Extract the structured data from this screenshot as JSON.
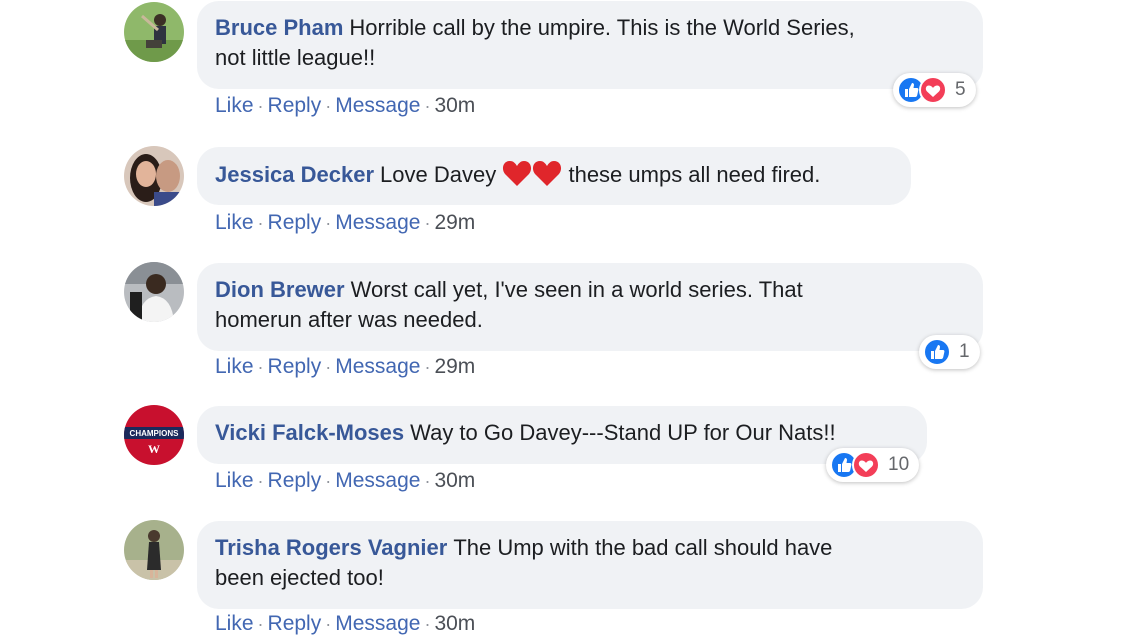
{
  "comments": [
    {
      "author": "Bruce Pham",
      "text": "Horrible call by the umpire. This is the World Series,",
      "text_line2": "not little league!!",
      "actions": {
        "like": "Like",
        "reply": "Reply",
        "message": "Message"
      },
      "time": "30m",
      "reactions": {
        "types": [
          "like-reaction-icon",
          "love-reaction-icon"
        ],
        "count": "5"
      }
    },
    {
      "author": "Jessica Decker",
      "text_before": "Love Davey",
      "text_after": "these umps all need fired.",
      "emoji": [
        "red-heart-emoji",
        "red-heart-emoji"
      ],
      "actions": {
        "like": "Like",
        "reply": "Reply",
        "message": "Message"
      },
      "time": "29m"
    },
    {
      "author": "Dion Brewer",
      "text": "Worst call yet, I've seen in a world series. That",
      "text_line2": "homerun after was needed.",
      "actions": {
        "like": "Like",
        "reply": "Reply",
        "message": "Message"
      },
      "time": "29m",
      "reactions": {
        "types": [
          "like-reaction-icon"
        ],
        "count": "1"
      }
    },
    {
      "author": "Vicki Falck-Moses",
      "text": "Way to Go Davey---Stand UP for Our Nats!!",
      "actions": {
        "like": "Like",
        "reply": "Reply",
        "message": "Message"
      },
      "time": "30m",
      "reactions": {
        "types": [
          "like-reaction-icon",
          "love-reaction-icon"
        ],
        "count": "10"
      },
      "avatar_badge": "CHAMPIONS"
    },
    {
      "author": "Trisha Rogers Vagnier",
      "text": "The Ump with the bad call should have",
      "text_line2": "been ejected too!",
      "actions": {
        "like": "Like",
        "reply": "Reply",
        "message": "Message"
      },
      "time": "30m"
    }
  ],
  "separator": "·",
  "colors": {
    "author": "#385898",
    "action": "#4267b2",
    "bubble": "#f0f2f5",
    "like": "#1877f2",
    "love": "#f33e58"
  }
}
